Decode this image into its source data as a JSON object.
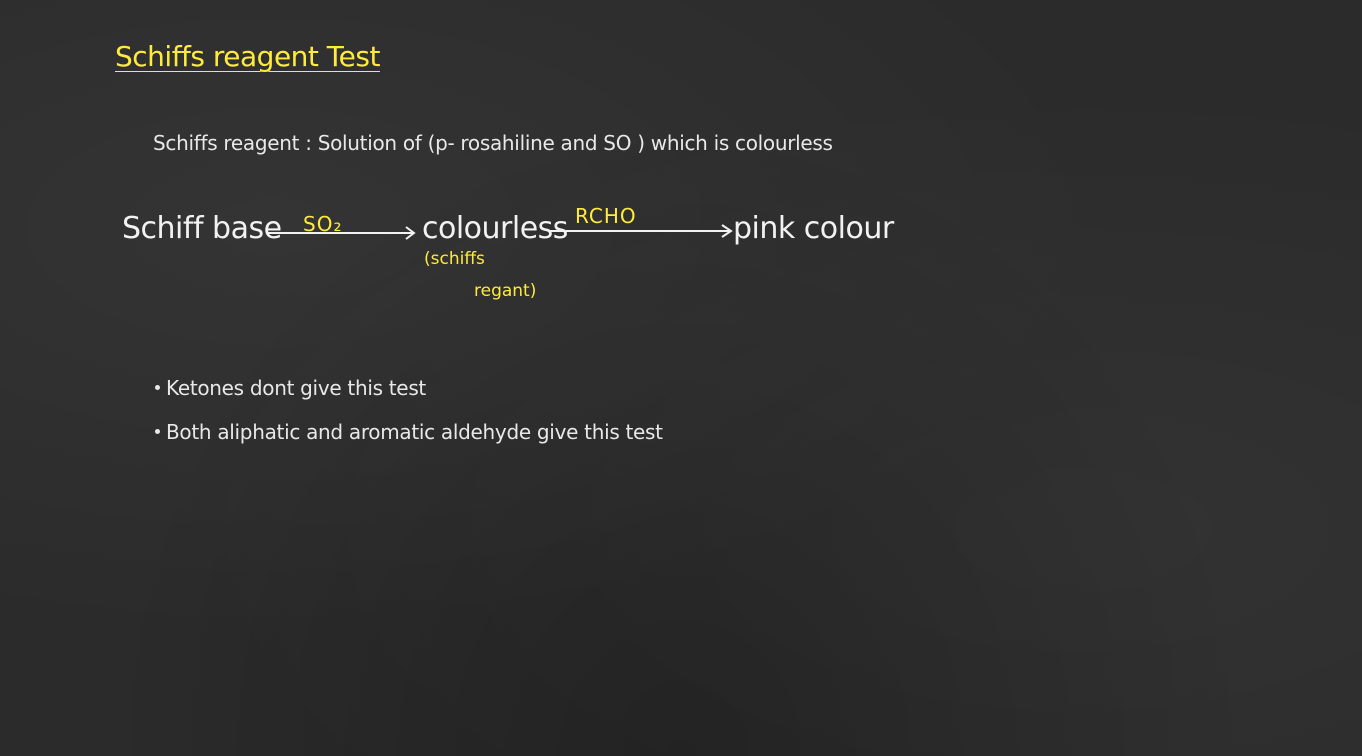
{
  "page": {
    "title": "Schiffs reagent Test",
    "definition": "Schiffs reagent  :  Solution of (p- rosahiline and SO ) which is colourless"
  },
  "reaction": {
    "reactant": "Schiff base",
    "step1_reagent": "SO₂",
    "intermediate": "colourless",
    "intermediate_note_line1": "(schiffs",
    "intermediate_note_line2": "regant)",
    "step2_reagent": "RCHO",
    "product": "pink colour"
  },
  "bullets": [
    "Ketones dont give this test",
    "Both aliphatic and aromatic aldehyde give this test"
  ],
  "colors": {
    "background": "#2b2b2b",
    "chalk": "#eeeeee",
    "highlight": "#ffeb3b"
  }
}
